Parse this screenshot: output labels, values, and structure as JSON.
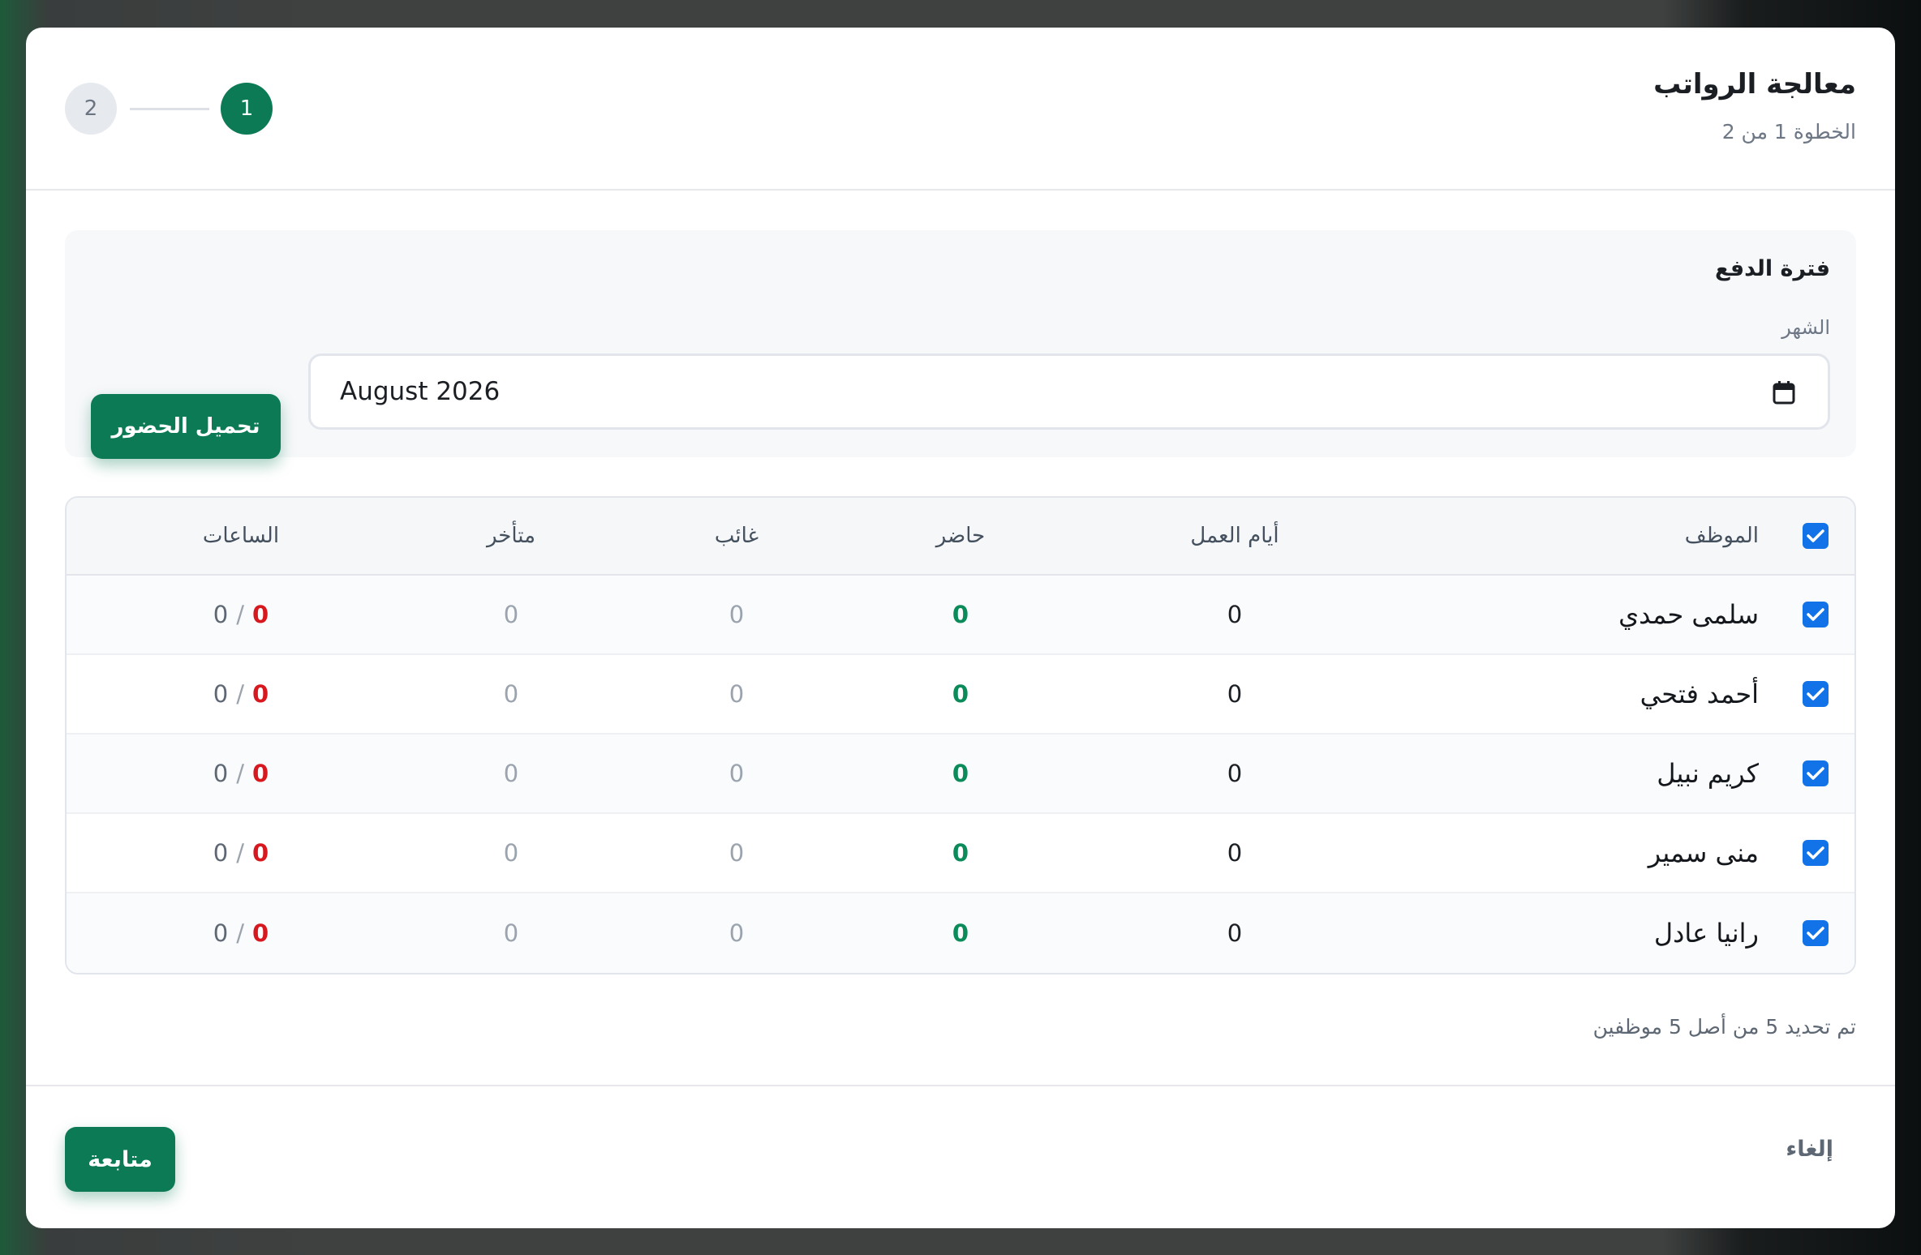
{
  "header": {
    "title": "معالجة الرواتب",
    "subtitle": "الخطوة 1 من 2",
    "steps": [
      "1",
      "2"
    ],
    "current_step": 1
  },
  "period": {
    "section_title": "فترة الدفع",
    "month_label": "الشهر",
    "month_value": "August  2026",
    "load_button": "تحميل الحضور"
  },
  "table": {
    "columns": {
      "employee": "الموظف",
      "work_days": "أيام العمل",
      "present": "حاضر",
      "absent": "غائب",
      "late": "متأخر",
      "hours": "الساعات"
    },
    "select_all_checked": true,
    "rows": [
      {
        "checked": true,
        "name": "سلمى حمدي",
        "work_days": "0",
        "present": "0",
        "absent": "0",
        "late": "0",
        "hours_worked": "0",
        "hours_total": "0"
      },
      {
        "checked": true,
        "name": "أحمد فتحي",
        "work_days": "0",
        "present": "0",
        "absent": "0",
        "late": "0",
        "hours_worked": "0",
        "hours_total": "0"
      },
      {
        "checked": true,
        "name": "كريم نبيل",
        "work_days": "0",
        "present": "0",
        "absent": "0",
        "late": "0",
        "hours_worked": "0",
        "hours_total": "0"
      },
      {
        "checked": true,
        "name": "منى سمير",
        "work_days": "0",
        "present": "0",
        "absent": "0",
        "late": "0",
        "hours_worked": "0",
        "hours_total": "0"
      },
      {
        "checked": true,
        "name": "رانيا عادل",
        "work_days": "0",
        "present": "0",
        "absent": "0",
        "late": "0",
        "hours_worked": "0",
        "hours_total": "0"
      }
    ]
  },
  "selection_summary": "تم تحديد 5 من أصل 5 موظفين",
  "footer": {
    "cancel_button": "إلغاء",
    "continue_button": "متابعة"
  },
  "colors": {
    "primary": "#0b7a55",
    "checkbox": "#1273e8",
    "present_value": "#0b8a5a",
    "hours_worked": "#d7191f"
  },
  "icons": {
    "month_picker": "calendar-icon",
    "checkbox_mark": "check-icon"
  },
  "hours_separator": "/"
}
